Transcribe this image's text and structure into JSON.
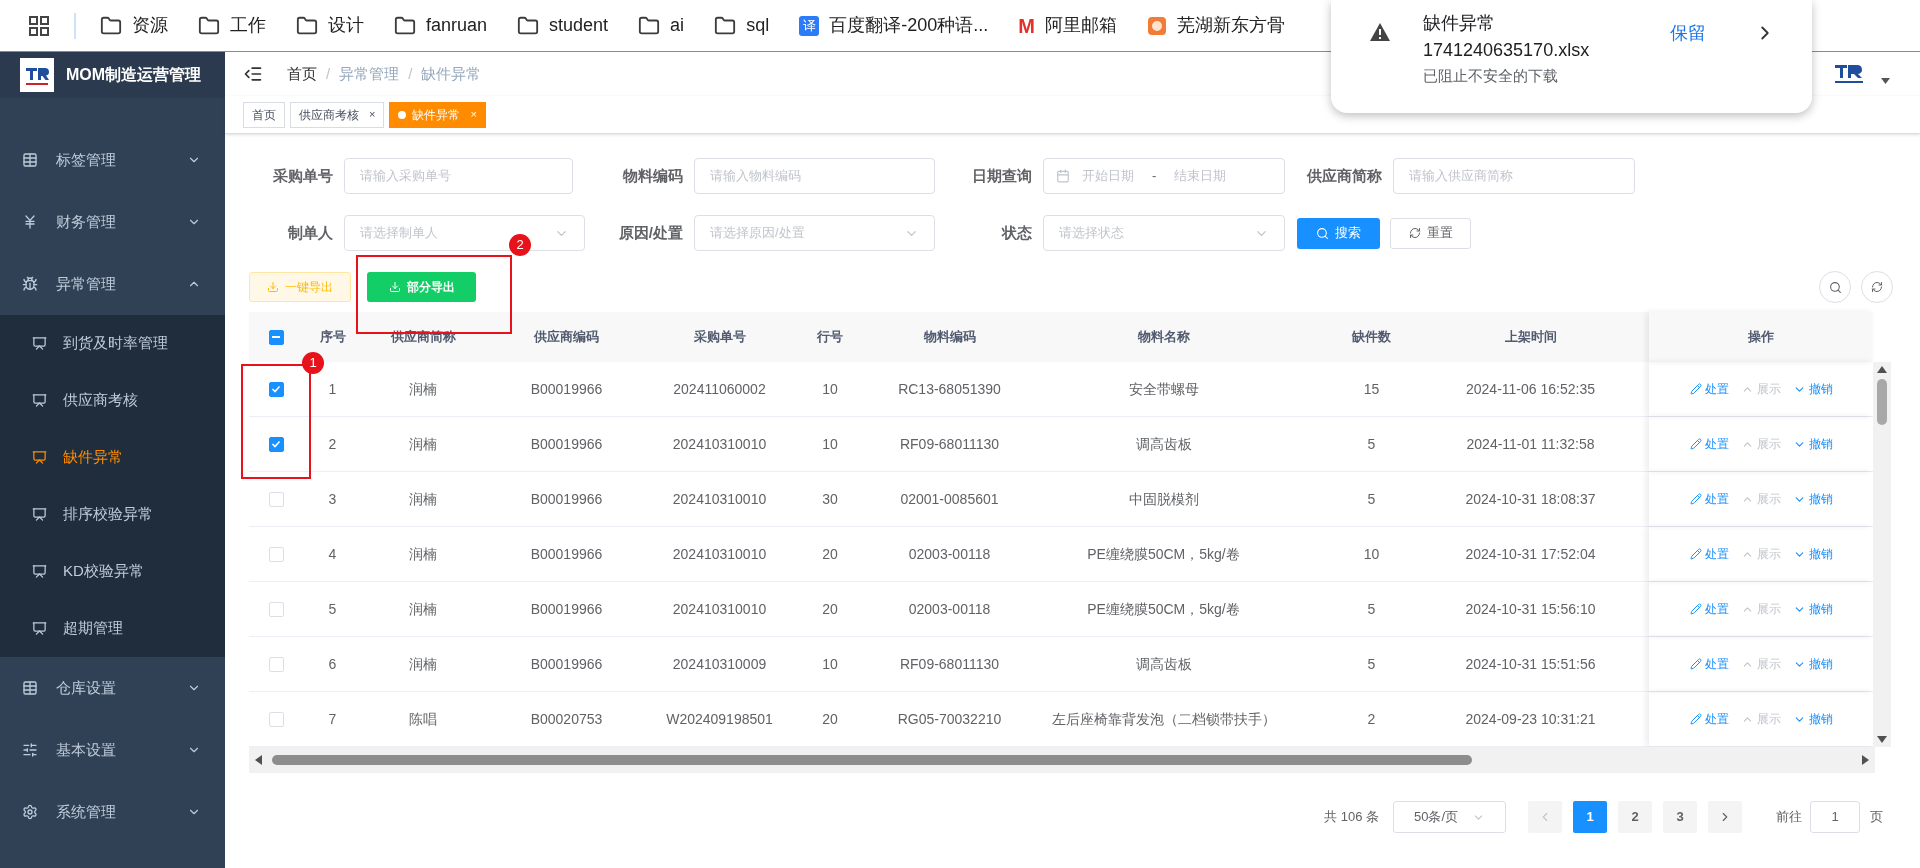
{
  "bookmarks": [
    {
      "label": "资源",
      "kind": "folder"
    },
    {
      "label": "工作",
      "kind": "folder"
    },
    {
      "label": "设计",
      "kind": "folder"
    },
    {
      "label": "fanruan",
      "kind": "folder"
    },
    {
      "label": "student",
      "kind": "folder"
    },
    {
      "label": "ai",
      "kind": "folder"
    },
    {
      "label": "sql",
      "kind": "folder"
    },
    {
      "label": "百度翻译-200种语...",
      "kind": "translate",
      "icon_text": "译"
    },
    {
      "label": "阿里邮箱",
      "kind": "mail",
      "icon_text": "M"
    },
    {
      "label": "芜湖新东方骨",
      "kind": "site"
    }
  ],
  "download_popup": {
    "title": "缺件异常",
    "filename": "1741240635170.xlsx",
    "status": "已阻止不安全的下载",
    "action": "保留"
  },
  "sidebar": {
    "title": "MOM制造运营管理",
    "items": [
      {
        "label": "标签管理",
        "kind": "grid",
        "expanded": false,
        "selected": false
      },
      {
        "label": "财务管理",
        "kind": "yen",
        "expanded": false,
        "selected": false
      },
      {
        "label": "异常管理",
        "kind": "bug",
        "expanded": true,
        "selected": false,
        "children": [
          {
            "label": "到货及时率管理",
            "selected": false
          },
          {
            "label": "供应商考核",
            "selected": false
          },
          {
            "label": "缺件异常",
            "selected": true
          },
          {
            "label": "排序校验异常",
            "selected": false
          },
          {
            "label": "KD校验异常",
            "selected": false
          },
          {
            "label": "超期管理",
            "selected": false
          }
        ]
      },
      {
        "label": "仓库设置",
        "kind": "grid",
        "expanded": false,
        "selected": false
      },
      {
        "label": "基本设置",
        "kind": "sliders",
        "expanded": false,
        "selected": false
      },
      {
        "label": "系统管理",
        "kind": "gear",
        "expanded": false,
        "selected": false
      }
    ]
  },
  "breadcrumb": [
    {
      "label": "首页"
    },
    {
      "separator": "/",
      "label": "异常管理"
    },
    {
      "separator": "/",
      "label": "缺件异常"
    }
  ],
  "tabs": [
    {
      "label": "首页",
      "selected": false
    },
    {
      "label": "供应商考核",
      "selected": false,
      "close": "×"
    },
    {
      "label": "缺件异常",
      "selected": true,
      "close": "×"
    }
  ],
  "filters": [
    [
      {
        "label": "采购单号",
        "kind": "input",
        "placeholder": "请输入采购单号"
      },
      {
        "label": "物料编码",
        "kind": "input",
        "placeholder": "请输入物料编码"
      },
      {
        "label": "日期查询",
        "kind": "daterange",
        "placeholder": "开始日期",
        "separator": "-",
        "placeholder_end": "结束日期"
      },
      {
        "label": "供应商简称",
        "kind": "input",
        "placeholder": "请输入供应商简称"
      }
    ],
    [
      {
        "label": "制单人",
        "kind": "select",
        "placeholder": "请选择制单人"
      },
      {
        "label": "原因/处置",
        "kind": "select",
        "placeholder": "请选择原因/处置"
      },
      {
        "label": "状态",
        "kind": "select",
        "placeholder": "请选择状态"
      }
    ]
  ],
  "search_button": "搜索",
  "reset_button": "重置",
  "export_all_button": "一键导出",
  "export_selected_button": "部分导出",
  "table": {
    "header_indeterminate": true,
    "columns": [
      "序号",
      "供应商简称",
      "供应商编码",
      "采购单号",
      "行号",
      "物料编码",
      "物料名称",
      "缺件数",
      "上架时间",
      "操作"
    ],
    "rows": [
      {
        "checked": true,
        "cells": [
          "1",
          "润楠",
          "B00019966",
          "202411060002",
          "10",
          "RC13-68051390",
          "安全带螺母",
          "15",
          "2024-11-06 16:52:35"
        ],
        "actions": [
          {
            "label": "处置",
            "kind": "edit",
            "disabled": false
          },
          {
            "label": "展示",
            "kind": "up",
            "disabled": true
          },
          {
            "label": "撤销",
            "kind": "down",
            "disabled": false
          }
        ]
      },
      {
        "checked": true,
        "cells": [
          "2",
          "润楠",
          "B00019966",
          "202410310010",
          "10",
          "RF09-68011130",
          "调高齿板",
          "5",
          "2024-11-01 11:32:58"
        ],
        "actions": [
          {
            "label": "处置",
            "kind": "edit",
            "disabled": false
          },
          {
            "label": "展示",
            "kind": "up",
            "disabled": true
          },
          {
            "label": "撤销",
            "kind": "down",
            "disabled": false
          }
        ]
      },
      {
        "checked": false,
        "cells": [
          "3",
          "润楠",
          "B00019966",
          "202410310010",
          "30",
          "02001-0085601",
          "中固脱模剂",
          "5",
          "2024-10-31 18:08:37"
        ],
        "actions": [
          {
            "label": "处置",
            "kind": "edit",
            "disabled": false
          },
          {
            "label": "展示",
            "kind": "up",
            "disabled": true
          },
          {
            "label": "撤销",
            "kind": "down",
            "disabled": false
          }
        ]
      },
      {
        "checked": false,
        "cells": [
          "4",
          "润楠",
          "B00019966",
          "202410310010",
          "20",
          "02003-00118",
          "PE缠绕膜50CM，5kg/卷",
          "10",
          "2024-10-31 17:52:04"
        ],
        "actions": [
          {
            "label": "处置",
            "kind": "edit",
            "disabled": false
          },
          {
            "label": "展示",
            "kind": "up",
            "disabled": true
          },
          {
            "label": "撤销",
            "kind": "down",
            "disabled": false
          }
        ]
      },
      {
        "checked": false,
        "cells": [
          "5",
          "润楠",
          "B00019966",
          "202410310010",
          "20",
          "02003-00118",
          "PE缠绕膜50CM，5kg/卷",
          "5",
          "2024-10-31 15:56:10"
        ],
        "actions": [
          {
            "label": "处置",
            "kind": "edit",
            "disabled": false
          },
          {
            "label": "展示",
            "kind": "up",
            "disabled": true
          },
          {
            "label": "撤销",
            "kind": "down",
            "disabled": false
          }
        ]
      },
      {
        "checked": false,
        "cells": [
          "6",
          "润楠",
          "B00019966",
          "202410310009",
          "10",
          "RF09-68011130",
          "调高齿板",
          "5",
          "2024-10-31 15:51:56"
        ],
        "actions": [
          {
            "label": "处置",
            "kind": "edit",
            "disabled": false
          },
          {
            "label": "展示",
            "kind": "up",
            "disabled": true
          },
          {
            "label": "撤销",
            "kind": "down",
            "disabled": false
          }
        ]
      },
      {
        "checked": false,
        "cells": [
          "7",
          "陈唱",
          "B00020753",
          "W202409198501",
          "20",
          "RG05-70032210",
          "左后座椅靠背发泡（二档锁带扶手）",
          "2",
          "2024-09-23 10:31:21"
        ],
        "actions": [
          {
            "label": "处置",
            "kind": "edit",
            "disabled": false
          },
          {
            "label": "展示",
            "kind": "up",
            "disabled": true
          },
          {
            "label": "撤销",
            "kind": "down",
            "disabled": false
          }
        ]
      }
    ]
  },
  "pagination": {
    "total": "共 106 条",
    "page_size": "50条/页",
    "pages": [
      {
        "label": "1",
        "selected": true
      },
      {
        "label": "2",
        "selected": false
      },
      {
        "label": "3",
        "selected": false
      }
    ],
    "goto_label": "前往",
    "goto_value": "1",
    "goto_suffix": "页"
  },
  "annotations": [
    {
      "label": "1"
    },
    {
      "label": "2"
    }
  ]
}
